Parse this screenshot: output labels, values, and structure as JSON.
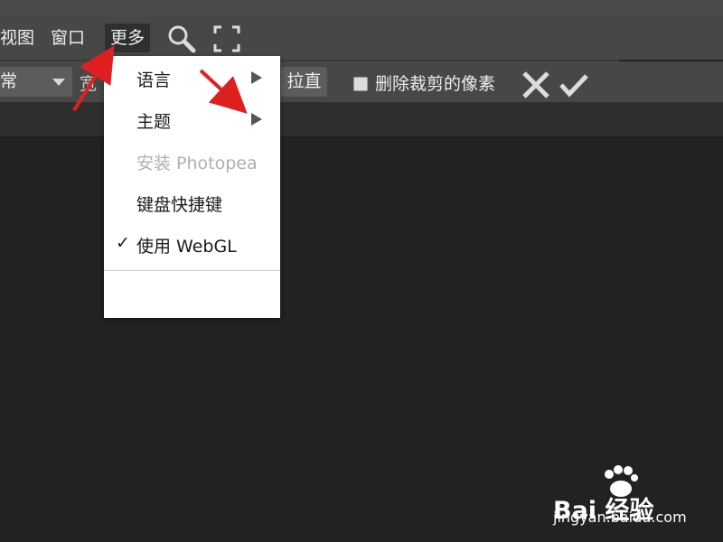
{
  "menubar": {
    "items": [
      "视图",
      "窗口",
      "更多"
    ],
    "active": "更多"
  },
  "optionsbar": {
    "mode_value": "常",
    "width_label": "宽",
    "straighten_label": "拉直",
    "delete_cropped_label": "删除裁剪的像素"
  },
  "dropdown": {
    "items": [
      {
        "label": "语言",
        "has_submenu": true
      },
      {
        "label": "主题",
        "has_submenu": true
      },
      {
        "label": "安装 Photopea",
        "disabled": true
      },
      {
        "label": "键盘快捷键"
      },
      {
        "label": "使用 WebGL",
        "checked": true
      }
    ],
    "check_glyph": "✓"
  },
  "watermark": {
    "brand_text": "Bai 经验",
    "url": "jingyan.baidu.com"
  },
  "colors": {
    "menubar_bg": "#474747",
    "workspace_bg": "#222222",
    "dropdown_bg": "#ffffff",
    "annotation_arrow": "#e02020"
  }
}
